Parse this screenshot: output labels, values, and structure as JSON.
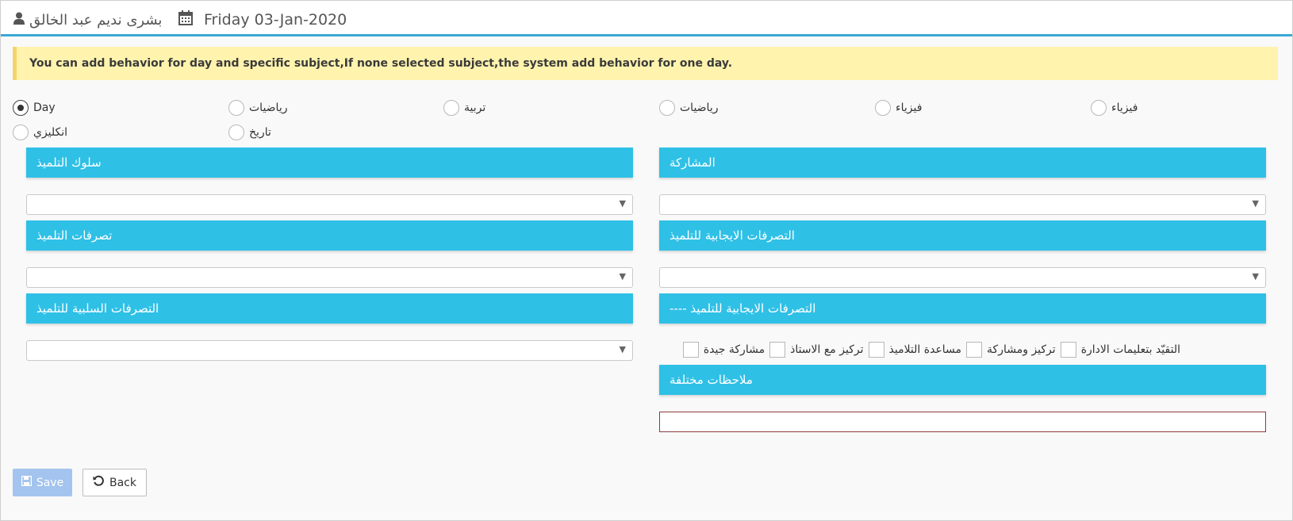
{
  "header": {
    "user_name": "بشرى نديم عبد الخالق",
    "user_icon": "user-icon",
    "calendar_icon": "calendar-icon",
    "date": "Friday 03-Jan-2020"
  },
  "notice": "You can add behavior for day and specific subject,If none selected subject,the system add behavior for one day.",
  "subjects": [
    {
      "label": "Day",
      "checked": true
    },
    {
      "label": "رياضيات",
      "checked": false
    },
    {
      "label": "تربية",
      "checked": false
    },
    {
      "label": "رياضيات",
      "checked": false
    },
    {
      "label": "فيزياء",
      "checked": false
    },
    {
      "label": "فيزياء",
      "checked": false
    },
    {
      "label": "انكليزي",
      "checked": false
    },
    {
      "label": "تاريخ",
      "checked": false
    }
  ],
  "sections": {
    "left": [
      {
        "title": "سلوك التلميذ"
      },
      {
        "title": "تصرفات التلميذ"
      },
      {
        "title": "التصرفات السلبية للتلميذ"
      }
    ],
    "right": [
      {
        "title": "المشاركة"
      },
      {
        "title": "التصرفات الايجابية للتلميذ"
      },
      {
        "title": "---- التصرفات الايجابية للتلميذ"
      },
      {
        "title": "ملاحظات مختلفة"
      }
    ]
  },
  "dropdown_arrow": "▼",
  "checkboxes": [
    "التقيّد بتعليمات الادارة",
    "تركيز ومشاركة",
    "مساعدة التلاميذ",
    "تركيز مع الاستاذ",
    "مشاركة جيدة"
  ],
  "buttons": {
    "save": "Save",
    "save_icon": "floppy-disk-icon",
    "back": "Back",
    "back_icon": "undo-icon"
  },
  "colors": {
    "section_header": "#2fc0e6",
    "top_border": "#3aa9d6",
    "notice_bg": "#fff3ae",
    "save_button": "#a3c4ee",
    "notes_border": "#8b3a3a"
  }
}
